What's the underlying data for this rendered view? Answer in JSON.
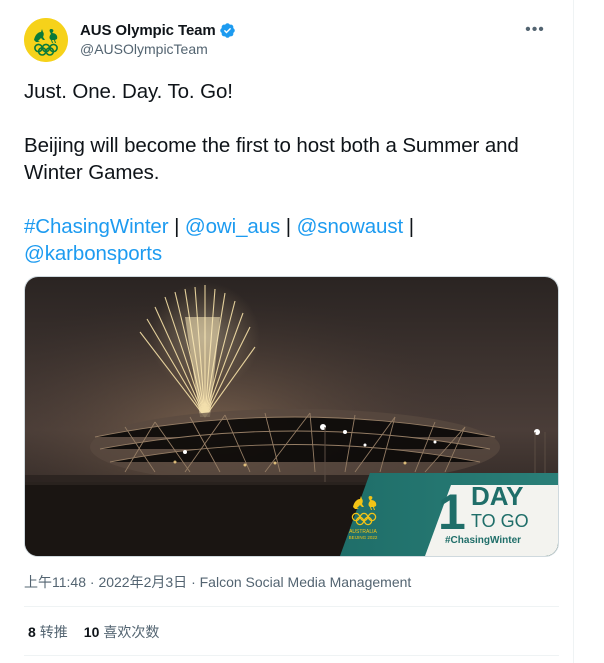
{
  "tweet": {
    "author": {
      "display_name": "AUS Olympic Team",
      "handle": "@AUSOlympicTeam",
      "verified": true,
      "avatar_colors": {
        "background": "#f6d21a",
        "emblem": "#0a7a3a"
      }
    },
    "more_icon": "more-horizontal-icon",
    "text": {
      "line1": "Just. One. Day. To. Go!",
      "line2": "Beijing will become the first to host both a Summer and Winter Games.",
      "links": {
        "hashtag": "#ChasingWinter",
        "mention1": "@owi_aus",
        "mention2": "@snowaust",
        "mention3": "@karbonsports"
      },
      "separator": "|"
    },
    "media": {
      "alt": "Fireworks over the Beijing National Stadium at night",
      "badge": {
        "country": "AUSTRALIA",
        "event": "BEIJING 2022",
        "big_number": "1",
        "day_word": "DAY",
        "to_go": "TO GO",
        "hashtag": "#ChasingWinter"
      }
    },
    "meta": {
      "time": "上午11:48",
      "dot": "·",
      "date": "2022年2月3日",
      "source": "Falcon Social Media Management"
    },
    "stats": {
      "retweets_count": "8",
      "retweets_label": "转推",
      "likes_count": "10",
      "likes_label": "喜欢次数"
    },
    "colors": {
      "link": "#1d9bf0",
      "secondary_text": "#536471",
      "primary_text": "#0f1419",
      "badge_teal": "#1e6b66",
      "badge_gold": "#f3c316"
    }
  }
}
